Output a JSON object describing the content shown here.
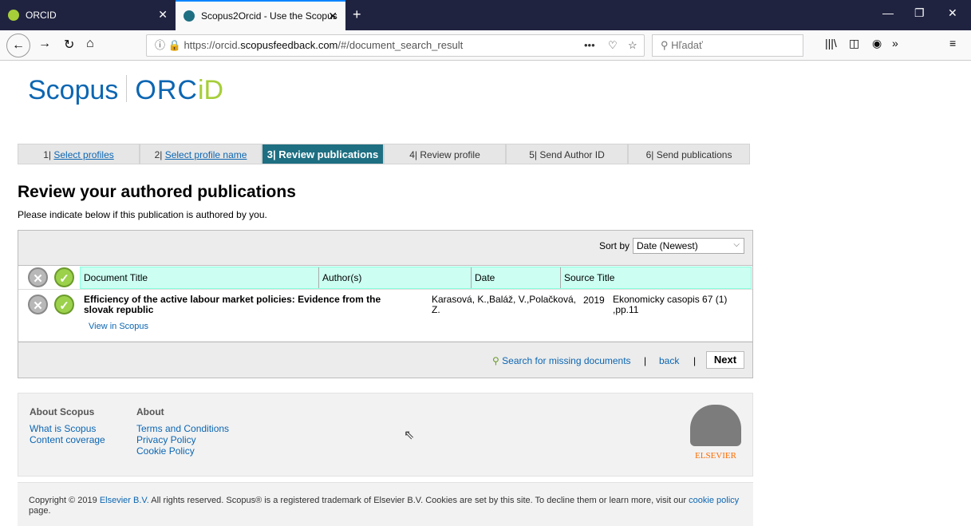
{
  "browser": {
    "tabs": [
      {
        "label": "ORCID"
      },
      {
        "label": "Scopus2Orcid - Use the Scopus"
      }
    ],
    "url_prefix": "https://orcid.",
    "url_domain": "scopusfeedback.com",
    "url_path": "/#/document_search_result",
    "search_placeholder": "Hľadať"
  },
  "logo": {
    "scopus": "Scopus",
    "orcid": "ORC",
    "id": "iD"
  },
  "steps": [
    {
      "num": "1",
      "label": "Select profiles"
    },
    {
      "num": "2",
      "label": "Select profile name"
    },
    {
      "num": "3",
      "label": "Review publications"
    },
    {
      "num": "4",
      "label": "Review profile"
    },
    {
      "num": "5",
      "label": "Send Author ID"
    },
    {
      "num": "6",
      "label": "Send publications"
    }
  ],
  "heading": "Review your authored publications",
  "instruction": "Please indicate below if this publication is authored by you.",
  "sort": {
    "label": "Sort by",
    "value": "Date (Newest)"
  },
  "table": {
    "columns": [
      "Document Title",
      "Author(s)",
      "Date",
      "Source Title"
    ],
    "rows": [
      {
        "title": "Efficiency of the active labour market policies: Evidence from the slovak republic",
        "view_link": "View in Scopus",
        "authors": "Karasová, K.,Baláž, V.,Polačková, Z.",
        "date": "2019",
        "source": "Ekonomicky casopis 67 (1) ,pp.11"
      }
    ]
  },
  "actions": {
    "missing": "Search for missing documents",
    "back": "back",
    "next": "Next"
  },
  "footer": {
    "col1": {
      "heading": "About Scopus",
      "links": [
        "What is Scopus",
        "Content coverage"
      ]
    },
    "col2": {
      "heading": "About",
      "links": [
        "Terms and Conditions",
        "Privacy Policy",
        "Cookie Policy"
      ]
    },
    "elsevier": "ELSEVIER",
    "copyright_a": "Copyright © 2019 ",
    "copyright_link": "Elsevier B.V.",
    "copyright_b": " All rights reserved. Scopus® is a registered trademark of Elsevier B.V. Cookies are set by this site. To decline them or learn more, visit our ",
    "cookie_link": "cookie policy",
    "copyright_c": " page."
  }
}
